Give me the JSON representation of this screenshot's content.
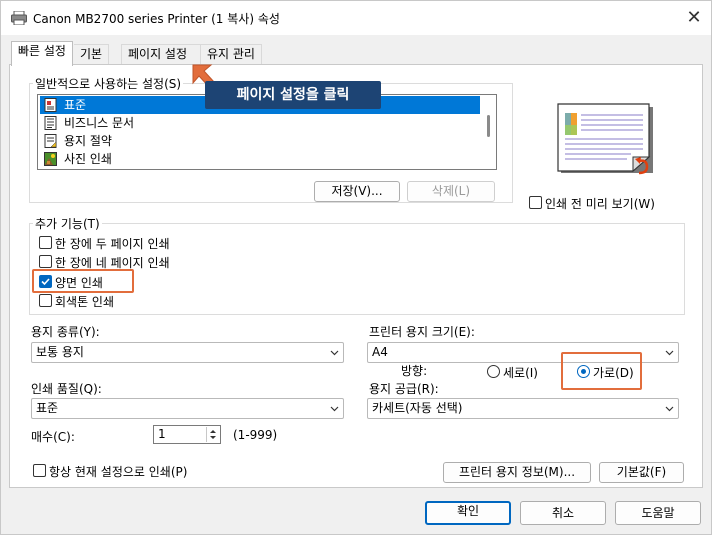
{
  "window": {
    "title": "Canon MB2700 series Printer (1 복사) 속성",
    "close_glyph": "✕"
  },
  "tabs": [
    {
      "label": "빠른 설정",
      "active": true
    },
    {
      "label": "기본",
      "active": false
    },
    {
      "label": "페이지 설정",
      "active": false
    },
    {
      "label": "유지 관리",
      "active": false
    }
  ],
  "callout": {
    "text": "페이지 설정을 클릭",
    "color": "#1d4474",
    "arrow_color": "#e26d3c"
  },
  "common_settings": {
    "label": "일반적으로 사용하는 설정(S)",
    "items": [
      {
        "label": "표준",
        "icon": "standard-doc-icon",
        "selected": true
      },
      {
        "label": "비즈니스 문서",
        "icon": "business-doc-icon",
        "selected": false
      },
      {
        "label": "용지 절약",
        "icon": "paper-saving-icon",
        "selected": false
      },
      {
        "label": "사진 인쇄",
        "icon": "photo-print-icon",
        "selected": false
      }
    ],
    "save_button": "저장(V)...",
    "delete_button": "삭제(L)"
  },
  "preview": {
    "checkbox_label": "인쇄 전 미리 보기(W)",
    "checked": false
  },
  "additional_features": {
    "label": "추가 기능(T)",
    "options": [
      {
        "label": "한 장에 두 페이지 인쇄",
        "checked": false
      },
      {
        "label": "한 장에 네 페이지 인쇄",
        "checked": false
      },
      {
        "label": "양면 인쇄",
        "checked": true
      },
      {
        "label": "회색톤 인쇄",
        "checked": false
      }
    ]
  },
  "media_type": {
    "label": "용지 종류(Y):",
    "value": "보통 용지"
  },
  "printer_paper_size": {
    "label": "프린터 용지 크기(E):",
    "value": "A4"
  },
  "orientation": {
    "label": "방향:",
    "options": [
      {
        "label": "세로(I)",
        "checked": false
      },
      {
        "label": "가로(D)",
        "checked": true
      }
    ]
  },
  "print_quality": {
    "label": "인쇄 품질(Q):",
    "value": "표준"
  },
  "paper_source": {
    "label": "용지 공급(R):",
    "value": "카세트(자동 선택)"
  },
  "copies": {
    "label": "매수(C):",
    "value": "1",
    "range": "(1-999)"
  },
  "always_print_current": {
    "label": "항상 현재 설정으로 인쇄(P)",
    "checked": false
  },
  "paper_info_button": "프린터 용지 정보(M)...",
  "defaults_button": "기본값(F)",
  "footer": {
    "ok": "확인",
    "cancel": "취소",
    "help": "도움말"
  },
  "colors": {
    "accent": "#0067c0",
    "selection": "#0078d7",
    "highlight_box": "#e26d3c"
  }
}
